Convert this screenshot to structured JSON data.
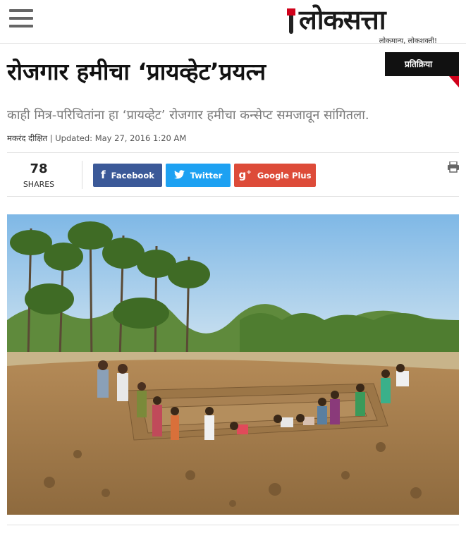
{
  "header": {
    "menu_icon": "hamburger-menu-icon",
    "logo_text": "लोकसत्ता",
    "logo_tagline": "लोकमान्य, लोकशक्ती!"
  },
  "article": {
    "title": "रोजगार हमीचा ‘प्रायव्हेट’प्रयत्न",
    "section_badge": "प्रतिक्रिया",
    "subtitle": "काही मित्र-परिचितांना हा ‘प्रायव्हेट’ रोजगार हमीचा कन्सेप्ट समजावून सांगितला.",
    "author": "मकरंद दीक्षित",
    "updated": "| Updated: May 27, 2016 1:20 AM"
  },
  "share": {
    "count": "78",
    "count_label": "SHARES",
    "buttons": [
      {
        "label": "Facebook",
        "icon": "facebook-icon",
        "color": "#3b5998"
      },
      {
        "label": "Twitter",
        "icon": "twitter-icon",
        "color": "#1da1f2"
      },
      {
        "label": "Google Plus",
        "icon": "google-plus-icon",
        "color": "#dd4b39"
      }
    ],
    "print_icon": "printer-icon"
  },
  "colors": {
    "accent": "#d0021b",
    "badge_bg": "#111111",
    "subtitle": "#7a7a7a"
  }
}
